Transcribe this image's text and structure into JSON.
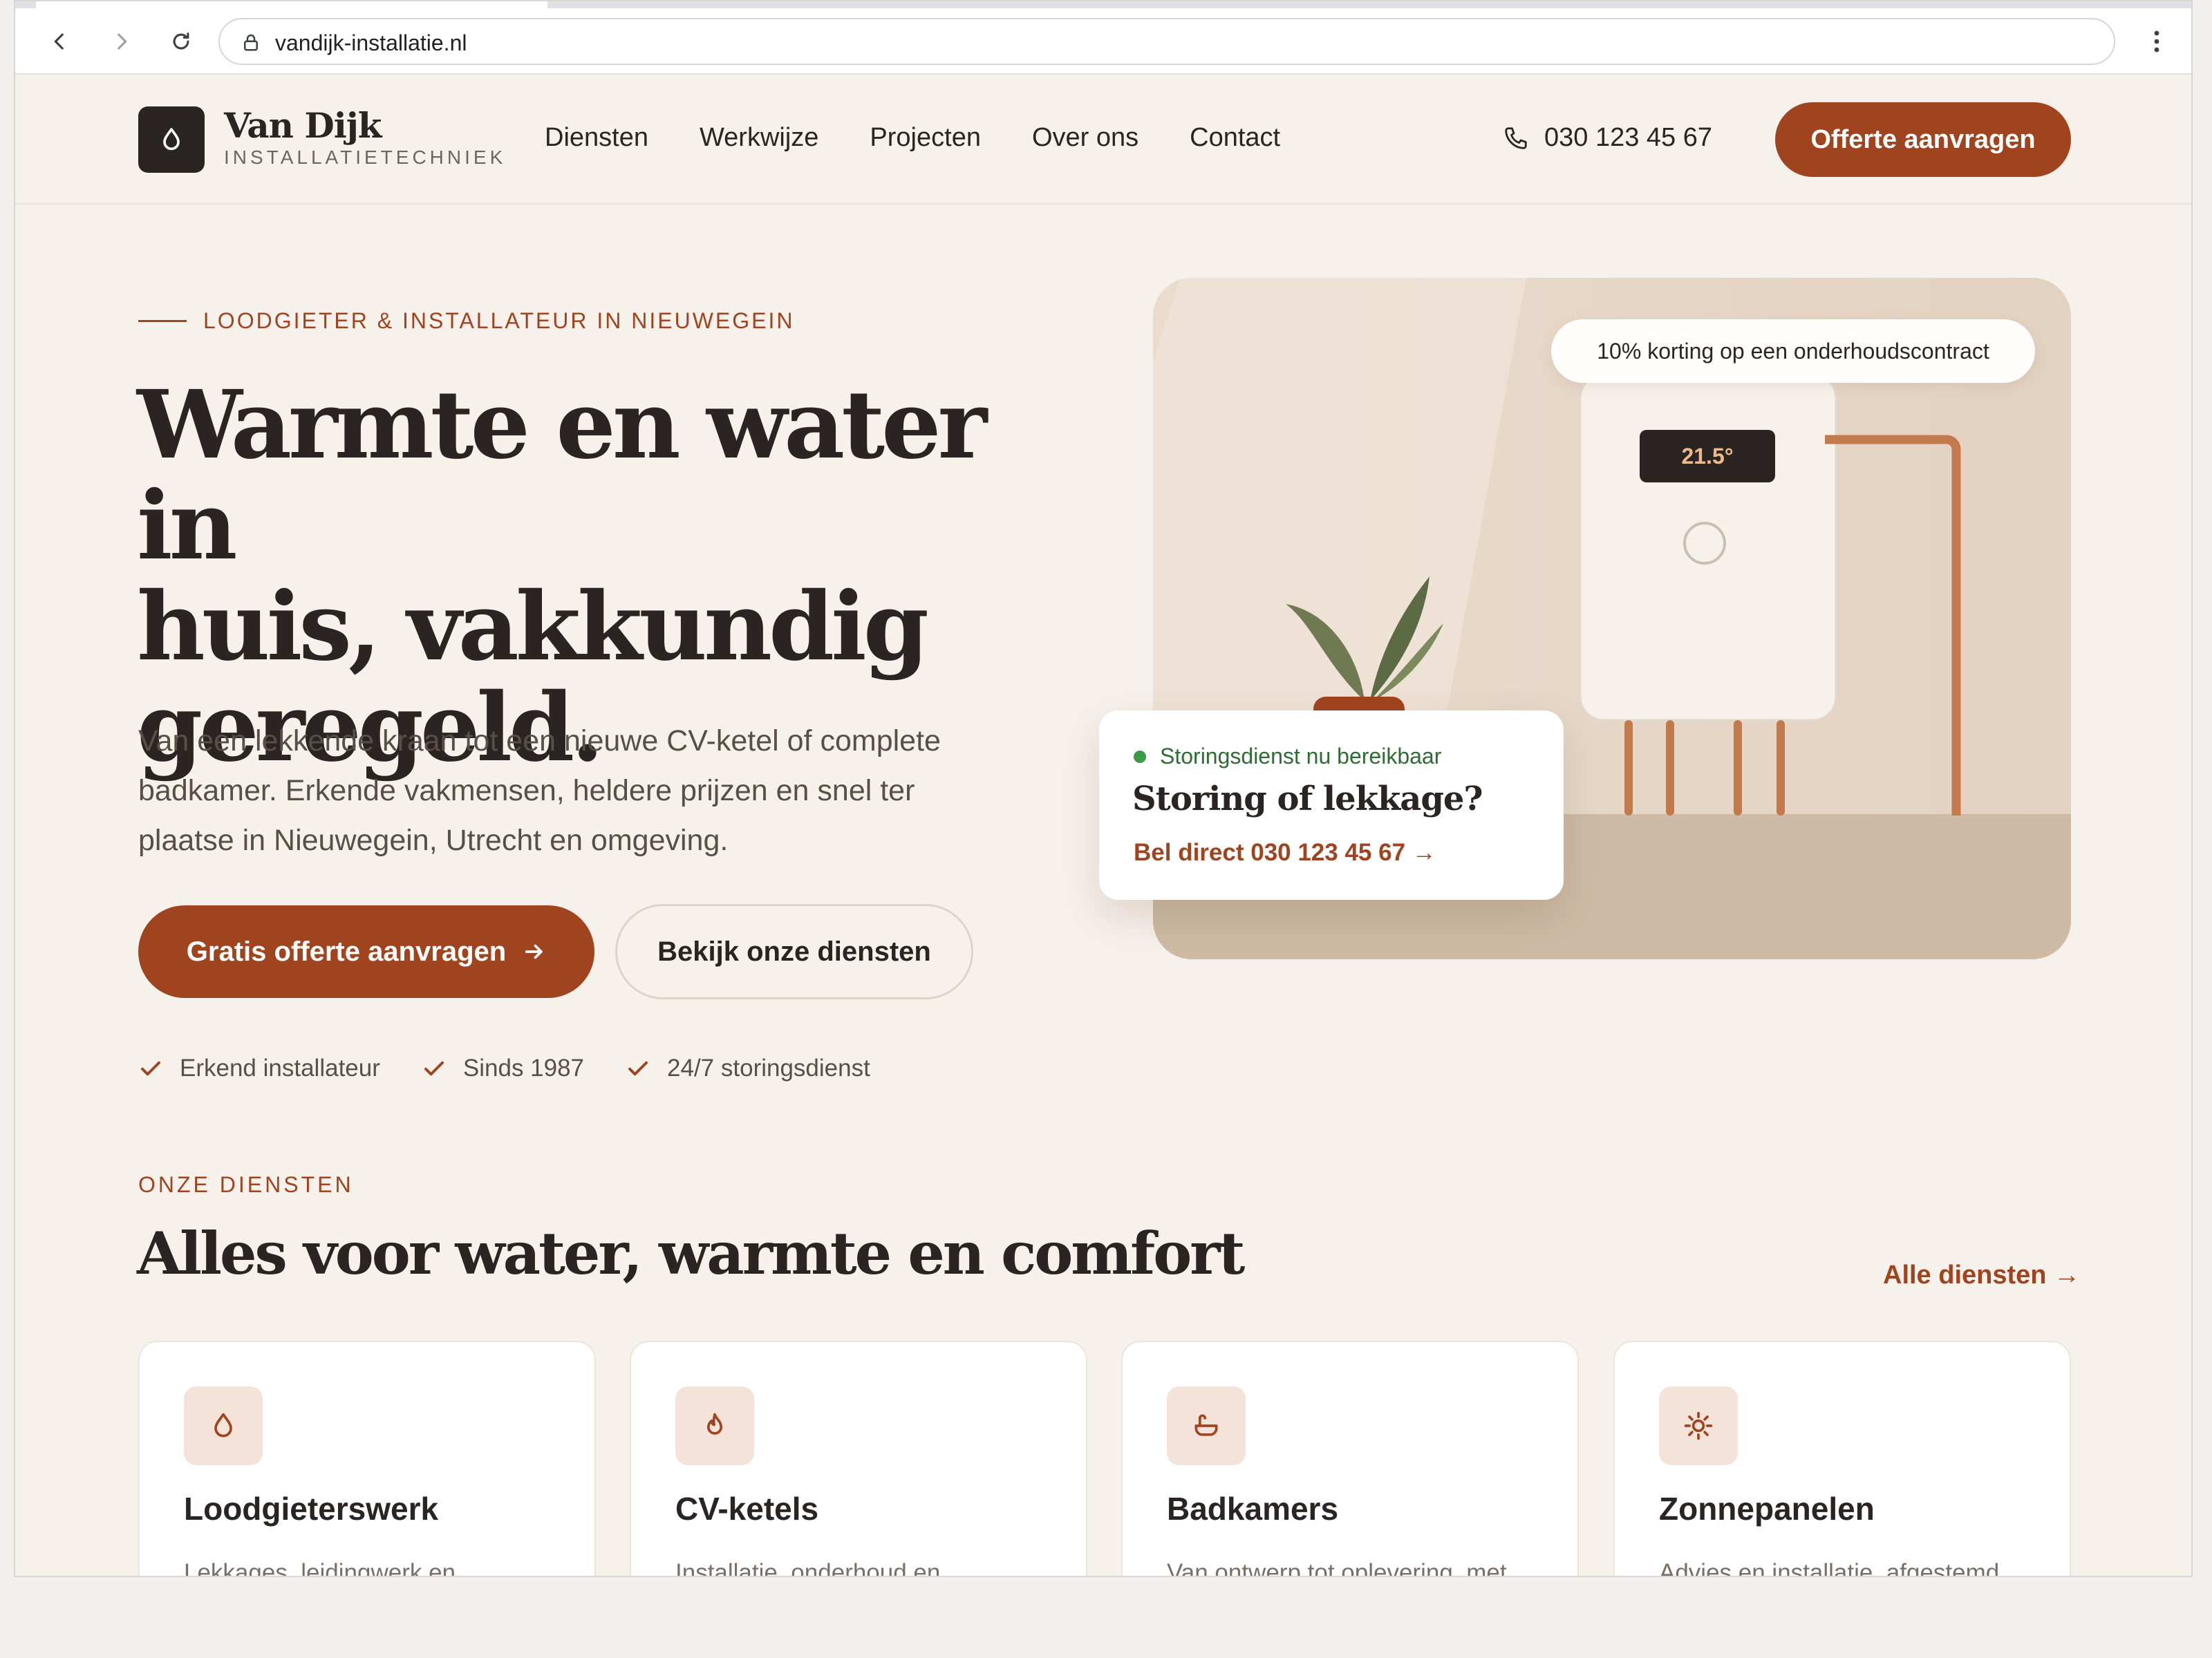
{
  "browser": {
    "url": "vandijk-installatie.nl"
  },
  "header": {
    "brand_name": "Van Dijk",
    "brand_sub": "INSTALLATIETECHNIEK",
    "nav": [
      "Diensten",
      "Werkwijze",
      "Projecten",
      "Over ons",
      "Contact"
    ],
    "phone": "030 123 45 67",
    "cta": "Offerte aanvragen"
  },
  "hero": {
    "eyebrow": "LOODGIETER & INSTALLATEUR IN NIEUWEGEIN",
    "title_line1": "Warmte en water in",
    "title_line2": "huis, vakkundig",
    "title_line3": "geregeld.",
    "text": "Van een lekkende kraan tot een nieuwe CV-ketel of complete badkamer. Erkende vakmensen, heldere prijzen en snel ter plaatse in Nieuwegein, Utrecht en omgeving.",
    "primary_cta": "Gratis offerte aanvragen",
    "secondary_cta": "Bekijk onze diensten",
    "trust": [
      "Erkend installateur",
      "Sinds 1987",
      "24/7 storingsdienst"
    ]
  },
  "illustration": {
    "promo": "10% korting op een onderhoudscontract",
    "temperature": "21.5°",
    "status": "Storingsdienst nu bereikbaar",
    "card_title": "Storing of lekkage?",
    "card_link": "Bel direct 030 123 45 67 →"
  },
  "services": {
    "eyebrow": "ONZE DIENSTEN",
    "title": "Alles voor water, warmte en comfort",
    "all_link": "Alle diensten →",
    "cards": [
      {
        "name": "Loodgieterswerk",
        "desc": "Lekkages, leidingwerk en",
        "icon": "drop-icon"
      },
      {
        "name": "CV-ketels",
        "desc": "Installatie, onderhoud en",
        "icon": "flame-icon"
      },
      {
        "name": "Badkamers",
        "desc": "Van ontwerp tot oplevering, met",
        "icon": "bathtub-icon"
      },
      {
        "name": "Zonnepanelen",
        "desc": "Advies en installatie, afgestemd",
        "icon": "sun-icon"
      }
    ]
  },
  "colors": {
    "accent": "#a0441f",
    "background": "#f7f1eb",
    "dark": "#2a2522",
    "status_green": "#3a9a45"
  }
}
